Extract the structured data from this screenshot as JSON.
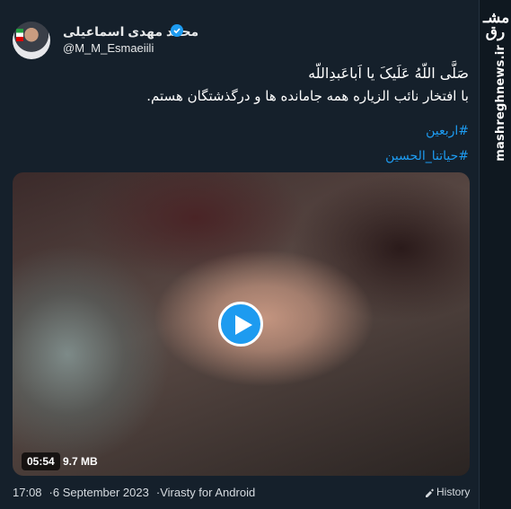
{
  "site": {
    "logo_text": "مشرق",
    "url": "mashreghnews.ir"
  },
  "author": {
    "display_name": "محمد مهدی اسماعیلی",
    "handle": "@M_M_Esmaeiili"
  },
  "tweet": {
    "line1": "صَلَّی اللّهُ عَلَیکَ یا اَباعَبدِاللّه",
    "line2": "با افتخار نائب الزیاره همه جامانده ها و درگذشتگان هستم.",
    "hashtags": [
      "#اربعین",
      "#حیاتنا_الحسین"
    ]
  },
  "video": {
    "duration": "05:54",
    "size": "9.7 MB"
  },
  "meta": {
    "time": "17:08",
    "date": "6 September 2023",
    "source": "Virasty for Android",
    "history_label": "History"
  },
  "colors": {
    "background": "#15202b",
    "accent": "#1d9bf0",
    "text": "#ffffff"
  },
  "icons": [
    "verified-badge-icon",
    "play-icon",
    "history-icon"
  ]
}
